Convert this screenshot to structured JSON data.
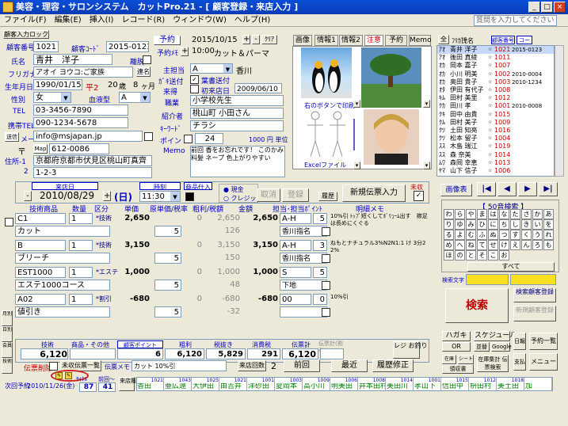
{
  "window": {
    "title": "美容・理容・サロンシステム　カットPro.21 - [ 顧客登録・来店入力 ]",
    "min": "_",
    "max": "□",
    "close": "×",
    "help_placeholder": "質問を入力してください"
  },
  "menu": [
    "ファイル(F)",
    "編集(E)",
    "挿入(I)",
    "レコード(R)",
    "ウィンドウ(W)",
    "ヘルプ(H)"
  ],
  "customer": {
    "unlock_label": "顧客入力ロック",
    "no_label": "顧客番号",
    "no": "1021",
    "code_label": "顧客ｺｰﾄﾞ",
    "code": "2015-0123",
    "name_label": "氏名",
    "name": "青井　洋子",
    "lapsed_label": "離脱",
    "kana_label": "フリガナ",
    "kana": "アオイ ヨウコ:ご家族",
    "link_label": "連名",
    "dob_label": "生年月日",
    "dob": "1990/01/15",
    "era": "平2",
    "age": "20",
    "age_unit": "歳",
    "months": "8",
    "month_unit": "ヶ月",
    "sex_label": "性別",
    "sex": "女",
    "blood_label": "血液型",
    "blood": "A",
    "tel_label": "TEL",
    "tel": "03-3456-7890",
    "mobile_label": "携帯TEL",
    "mobile": "090-1234-5678",
    "mail_btn": "送信",
    "mail_label": "メール",
    "email": "info@msjapan.jp",
    "zip_mark": "〒",
    "map_btn": "Map",
    "zip": "612-0086",
    "addr_label": "住所-1",
    "addr1": "京都府京都市伏見区桃山町真齊",
    "addr2_label": "2",
    "addr2": "1-2-3"
  },
  "profile": {
    "main_label": "主担当",
    "main_rank": "A",
    "main_staff": "香川",
    "dm_label": "ｶﾞｷ送付",
    "dm_check": "✓",
    "dm_value": "葉書送付",
    "visit_label": "来得",
    "first_label": "初来店日",
    "first_date": "2009/06/10",
    "job_label": "職業",
    "job": "小学校先生",
    "intro_label": "紹介者",
    "intro": "桃山町 小田さん",
    "kw_label": "ｷｰﾜｰﾄﾞ",
    "kw": "チラシ",
    "point_label": "ポイント",
    "point": "24",
    "point_note": "1000 円 単位",
    "memo_label": "Memo",
    "memo": "前回 香をお忘れです！ このかみ 料髪 ネープ 色上がりやすい"
  },
  "reservation": {
    "btn": "予約",
    "date": "2015/10/15",
    "plus": "+",
    "minus": "-",
    "clear": "ｸﾘｱ",
    "memo_btn": "予約ﾒﾓ",
    "time": "10:00",
    "menu": "カット＆パーマ"
  },
  "media": {
    "tabs": [
      "画像",
      "情報1",
      "情報2",
      "注意",
      "予約",
      "Memo"
    ],
    "img1_caption": "右のボタンで印刷",
    "img2_caption": "Excelファイル"
  },
  "visit": {
    "date_label": "来店日",
    "date": "2010/08/29",
    "weekday": "(日)",
    "time_label": "時刻",
    "time": "11:30",
    "gift_label": "商品仕入",
    "cash_label": "現金",
    "credit_label": "クレジット",
    "cancel": "取消",
    "register": "登録",
    "history": "履歴",
    "new_slip": "新規伝票入力",
    "unpaid": "未収"
  },
  "slip_header": [
    "技術商品",
    "数量",
    "区分",
    "単価",
    "原単価/税率",
    "粗利/税額",
    "金額",
    "担当･担当ﾎﾟｲﾝﾄ",
    "明細メモ"
  ],
  "slip_rows": [
    {
      "code": "C1",
      "qty": "1",
      "kind": "*技術",
      "price": "2,650",
      "cost": "0",
      "profit": "2,650",
      "amount": "2,650",
      "rank": "A-H",
      "pt": "5",
      "name": "カット",
      "tax_rate": "5",
      "tax": "126",
      "staff": "香川指名",
      "memo": "10%引 ﾄｯﾌﾟ短くしてﾎﾞﾘｭｰﾑ出す　襟足は長めにくぐる"
    },
    {
      "code": "B",
      "qty": "1",
      "kind": "*技術",
      "price": "3,150",
      "cost": "0",
      "profit": "3,150",
      "amount": "3,150",
      "rank": "A-H",
      "pt": "3",
      "name": "ブリーチ",
      "tax_rate": "5",
      "tax": "150",
      "staff": "香川指名",
      "memo": "ねもとナチュラル3%N2N1:1 け 3分2 2%"
    },
    {
      "code": "EST1000",
      "qty": "1",
      "kind": "*エステ",
      "price": "1,000",
      "cost": "0",
      "profit": "1,000",
      "amount": "1,000",
      "rank": "S",
      "pt": "5",
      "name": "エステ1000コース",
      "tax_rate": "5",
      "tax": "48",
      "staff": "下地",
      "memo": ""
    },
    {
      "code": "A02",
      "qty": "1",
      "kind": "*割引",
      "price": "-680",
      "cost": "0",
      "profit": "-680",
      "amount": "-680",
      "rank": "00",
      "pt": "0",
      "name": "値引き",
      "tax_rate": "5",
      "tax": "-32",
      "staff": "",
      "memo": "10%引"
    }
  ],
  "totals": {
    "tech_label": "技術",
    "goods_label": "商品・その他",
    "point_label": "顧客ポイント",
    "profit_label": "粗利",
    "tax_label": "税抜き",
    "consume_label": "消費税",
    "slip_label": "伝票計",
    "slip_sub": "伝票計(割引)",
    "tech": "6,120",
    "goods": "",
    "point": "6",
    "profit": "6,120",
    "taxex": "5,829",
    "tax": "291",
    "slip": "6,120",
    "receipt": "レジ お釣り"
  },
  "footer": {
    "del_label": "伝票削除",
    "unpaid_list": "未収伝票一覧",
    "slip_memo_label": "伝票メモ",
    "slip_memo": "カット 10%引",
    "visits_label": "来店回数",
    "visits": "2",
    "prev": "前回",
    "recent": "最近",
    "history_fix": "履歴修正",
    "next_label": "次回予約",
    "next_date": "2010/11/26(金)",
    "cycle_label": "ｻｲｸﾙ",
    "cycle": "87",
    "prev_days_label": "前回～",
    "prev_days": "41",
    "hist_label": "来店履歴"
  },
  "list": {
    "btn_all": "全",
    "kana_hdr": "ﾌﾘｶﾞﾅ",
    "name_hdr": "氏名",
    "no_hdr": "顧客番号",
    "code_hdr": "コード",
    "rows": [
      {
        "k": "ｱｵ",
        "n": "青井 洋子",
        "no": "1021",
        "code": "2015-0123"
      },
      {
        "k": "ｱｵ",
        "n": "後田 真綾",
        "no": "1011",
        "code": ""
      },
      {
        "k": "ｵｶ",
        "n": "岡本 嘉子",
        "no": "1007",
        "code": ""
      },
      {
        "k": "ｵｶ",
        "n": "小川 明美",
        "no": "1002",
        "code": "2010-0004"
      },
      {
        "k": "ｵｶ",
        "n": "奥田 貴子",
        "no": "1003",
        "code": "2010-1234"
      },
      {
        "k": "ｵﾀ",
        "n": "伊田 有代子",
        "no": "1008",
        "code": ""
      },
      {
        "k": "ｷﾑ",
        "n": "田村 美里",
        "no": "1012",
        "code": ""
      },
      {
        "k": "ｸｶ",
        "n": "田川 孝",
        "no": "1001",
        "code": "2010-0008"
      },
      {
        "k": "ｸｷ",
        "n": "田中 由貴",
        "no": "1015",
        "code": ""
      },
      {
        "k": "ｸﾑ",
        "n": "田村 美子",
        "no": "1009",
        "code": ""
      },
      {
        "k": "ｸﾂ",
        "n": "土田 知亮",
        "no": "1016",
        "code": ""
      },
      {
        "k": "ｸﾂ",
        "n": "松本 留子",
        "no": "1004",
        "code": ""
      },
      {
        "k": "ｽｽ",
        "n": "木島 瑞江",
        "no": "1019",
        "code": ""
      },
      {
        "k": "ｽｽ",
        "n": "森 奈美",
        "no": "1014",
        "code": ""
      },
      {
        "k": "ﾑﾜ",
        "n": "森岡 幸恵",
        "no": "1013",
        "code": ""
      },
      {
        "k": "ﾔﾏ",
        "n": "山下 信子",
        "no": "1006",
        "code": ""
      }
    ]
  },
  "nav": {
    "image_btn": "画像表",
    "first": "|◀",
    "prev": "◀",
    "next": "▶",
    "last": "▶|"
  },
  "kana50": {
    "title": "【 50音検索 】",
    "keys": [
      "わ",
      "ら",
      "や",
      "ま",
      "は",
      "な",
      "た",
      "さ",
      "か",
      "あ",
      "り",
      "ゆ",
      "み",
      "ひ",
      "に",
      "ち",
      "し",
      "き",
      "い",
      "を",
      "る",
      "よ",
      "む",
      "ふ",
      "ぬ",
      "つ",
      "す",
      "く",
      "う",
      "れ",
      "め",
      "へ",
      "ね",
      "て",
      "せ",
      "け",
      "え",
      "ん",
      "ろ",
      "も",
      "ほ",
      "の",
      "と",
      "そ",
      "こ",
      "お"
    ],
    "all": "すべて",
    "search_label": "検索文字"
  },
  "side": {
    "search": "検索",
    "search_reg": "検索顧客登録",
    "new_reg": "新規顧客登録",
    "hagaki": "ハガキ",
    "schedule": "スケジュール",
    "or": "OR",
    "sort": "並替",
    "google": "Google",
    "daily": "日報",
    "reserve_list": "予約一覧",
    "stock": "在庫",
    "wait": "シート",
    "cust_sum": "在庫集計 伝票検索",
    "pay": "支払",
    "menu": "メニュー",
    "receipt_list": "領収書"
  },
  "history": [
    {
      "no": "1021",
      "name": "香田"
    },
    {
      "no": "1043",
      "name": "亜広遠"
    },
    {
      "no": "1025",
      "name": "大伊田"
    },
    {
      "no": "1021",
      "name": "由吉井"
    },
    {
      "no": "1001",
      "name": "洋砂田"
    },
    {
      "no": "1003",
      "name": "夏岡本"
    },
    {
      "no": "1009",
      "name": "高小川"
    },
    {
      "no": "1006",
      "name": "明美田"
    },
    {
      "no": "1008",
      "name": "井本田村"
    },
    {
      "no": "1014",
      "name": "美田川"
    },
    {
      "no": "1001",
      "name": "孝山下"
    },
    {
      "no": "1015",
      "name": "信田中"
    },
    {
      "no": "1012",
      "name": "枡田村"
    },
    {
      "no": "1018",
      "name": "美土田"
    },
    {
      "no": "",
      "name": "加"
    }
  ]
}
